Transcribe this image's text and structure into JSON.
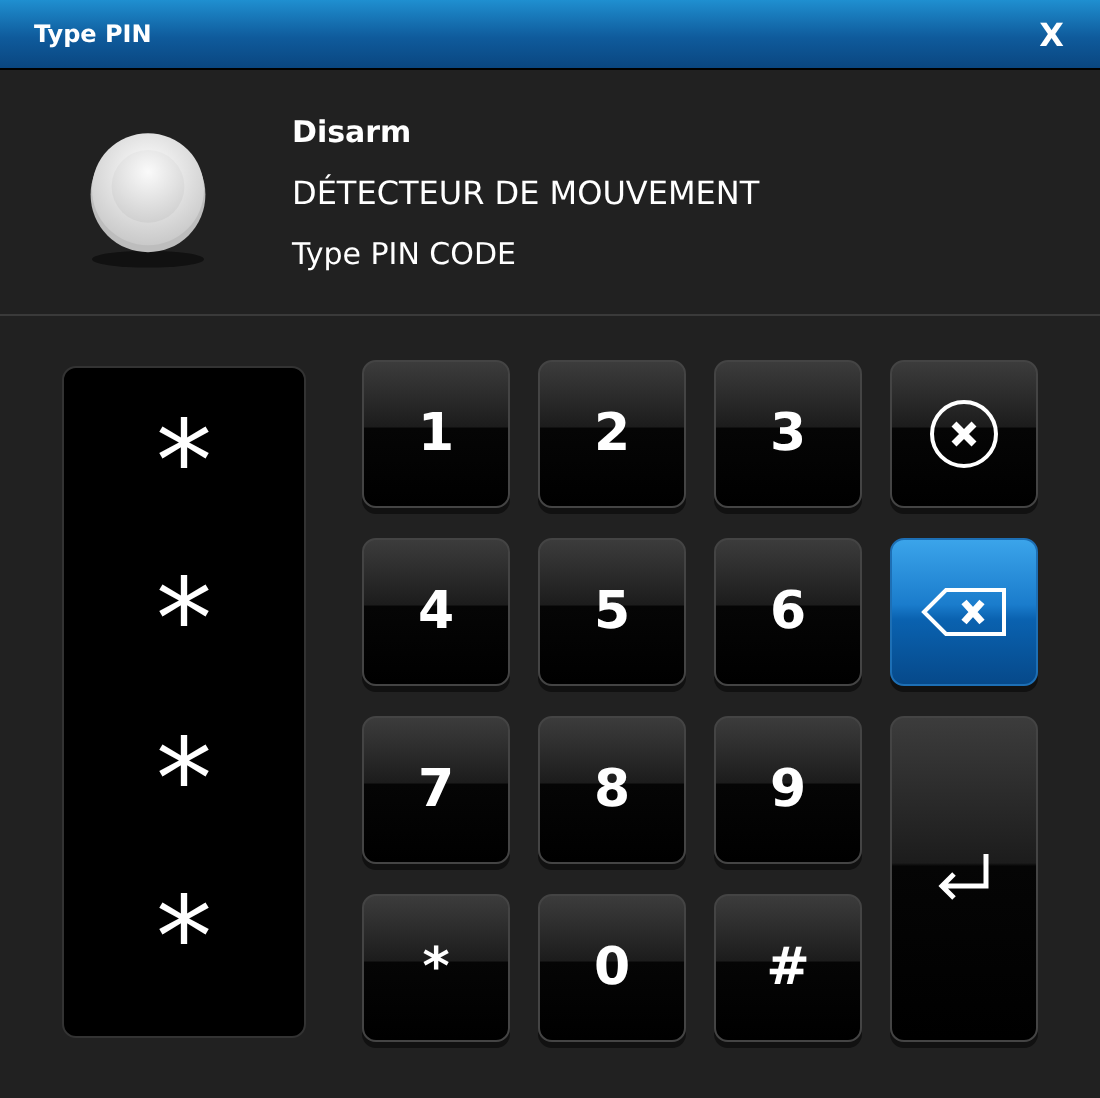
{
  "window": {
    "title": "Type PIN",
    "close": "X"
  },
  "header": {
    "action": "Disarm",
    "device": "DÉTECTEUR DE MOUVEMENT",
    "prompt": "Type PIN CODE"
  },
  "display": [
    "*",
    "*",
    "*",
    "*"
  ],
  "keys": [
    {
      "kind": "digit",
      "label": "1",
      "highlighted": false
    },
    {
      "kind": "digit",
      "label": "2",
      "highlighted": false
    },
    {
      "kind": "digit",
      "label": "3",
      "highlighted": false
    },
    {
      "kind": "clear",
      "highlighted": false
    },
    {
      "kind": "digit",
      "label": "4",
      "highlighted": false
    },
    {
      "kind": "digit",
      "label": "5",
      "highlighted": false
    },
    {
      "kind": "digit",
      "label": "6",
      "highlighted": false
    },
    {
      "kind": "backspace",
      "highlighted": true
    },
    {
      "kind": "digit",
      "label": "7",
      "highlighted": false
    },
    {
      "kind": "digit",
      "label": "8",
      "highlighted": false
    },
    {
      "kind": "digit",
      "label": "9",
      "highlighted": false
    },
    {
      "kind": "enter",
      "highlighted": false
    },
    {
      "kind": "digit",
      "label": "*",
      "highlighted": false
    },
    {
      "kind": "digit",
      "label": "0",
      "highlighted": false
    },
    {
      "kind": "digit",
      "label": "#",
      "highlighted": false
    }
  ]
}
